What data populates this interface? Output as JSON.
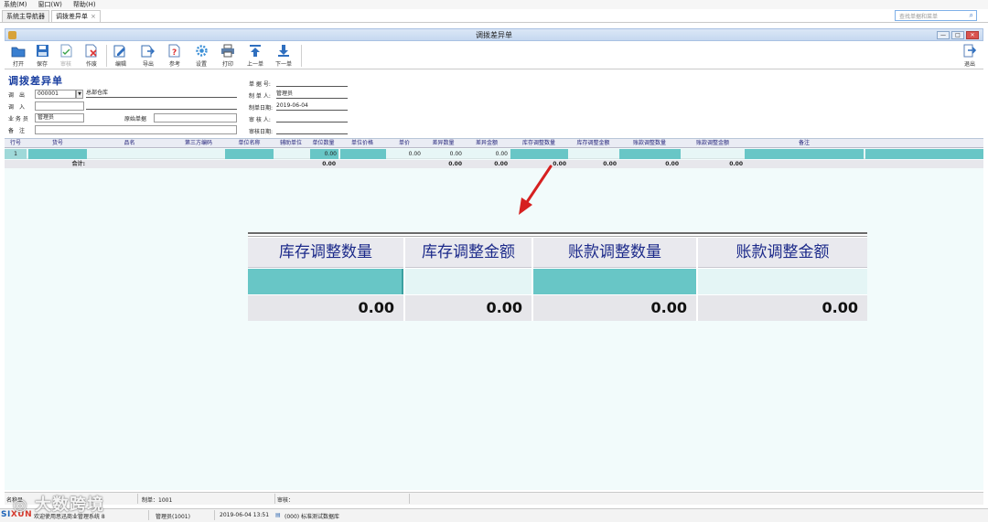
{
  "menubar": {
    "items": [
      "系统(M)",
      "窗口(W)",
      "帮助(H)"
    ]
  },
  "tabs": [
    {
      "label": "系统主导航器",
      "active": false
    },
    {
      "label": "调拨差异单",
      "active": true,
      "close": "×"
    }
  ],
  "search": {
    "placeholder": "查找单据和菜单"
  },
  "window": {
    "title": "调拨差异单",
    "buttons": [
      "—",
      "□",
      "✕"
    ]
  },
  "toolbar": {
    "open": "打开",
    "save": "保存",
    "review": "审核",
    "discard": "作废",
    "edit": "编辑",
    "export": "导出",
    "reference": "参考",
    "settings": "设置",
    "print": "打印",
    "prev": "上一单",
    "next": "下一单",
    "exit": "退出"
  },
  "form": {
    "title": "调拨差异单",
    "out_label": "调　出",
    "out_code": "000001",
    "out_name": "总部仓库",
    "in_label": "调　入",
    "staff_label": "业 务 员",
    "staff_value": "管理员",
    "source_label": "原始单据",
    "note_label": "备　注",
    "doc_no_label": "单 据 号:",
    "maker_label": "制 单 人:",
    "maker_value": "管理员",
    "make_date_label": "制单日期:",
    "make_date_value": "2019-06-04",
    "reviewer_label": "审 核 人:",
    "review_date_label": "审核日期:"
  },
  "grid": {
    "headers": [
      "行号",
      "货号",
      "品名",
      "第三方编码",
      "单位名称",
      "辅助单位",
      "单位数量",
      "单位价格",
      "单价",
      "差异数量",
      "差异金额",
      "库存调整数量",
      "库存调整金额",
      "账款调整数量",
      "账款调整金额",
      "备注"
    ],
    "row": {
      "no": "1",
      "unit_qty": "0.00",
      "price": "0.00",
      "diff_qty": "0.00",
      "diff_amount": "0.00"
    },
    "total": {
      "label": "合计:",
      "unit_qty": "0.00",
      "diff_qty": "0.00",
      "diff_amount": "0.00",
      "stock_qty": "0.00",
      "stock_amount": "0.00",
      "account_qty": "0.00",
      "account_amount": "0.00"
    }
  },
  "zoom": {
    "headers": [
      "库存调整数量",
      "库存调整金额",
      "账款调整数量",
      "账款调整金额"
    ],
    "values": [
      "0.00",
      "0.00",
      "0.00",
      "0.00"
    ]
  },
  "status1": {
    "a": "名称显",
    "maker": "制单：1001",
    "review": "审核："
  },
  "status2": {
    "logo_a": "SI",
    "logo_b": "XUN",
    "welcome": "欢迎使用思迅商业管理系统 8",
    "user": "管理员(1001)",
    "datetime": "2019-06-04 13:51",
    "db": "(000) 标准测试数据库"
  },
  "watermark": "大数跨境",
  "colors": {
    "accent": "#68c6c6",
    "title_blue": "#1a3fa0",
    "arrow_red": "#d62020"
  }
}
